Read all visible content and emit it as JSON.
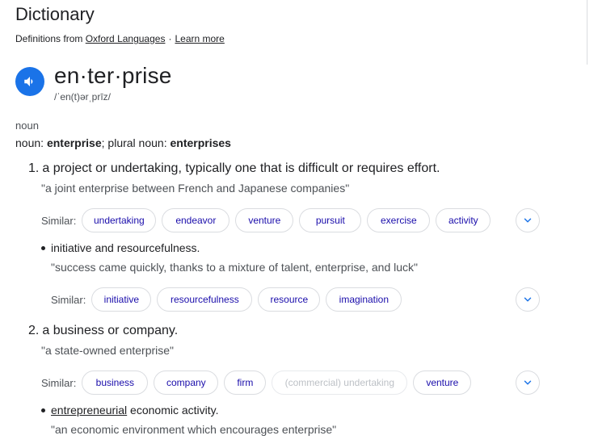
{
  "title": "Dictionary",
  "source": {
    "prefix": "Definitions from",
    "provider_link": "Oxford Languages",
    "separator": "·",
    "learn_more": "Learn more"
  },
  "entry": {
    "headword": "en·ter·prise",
    "phonetic": "/ˈen(t)ərˌprīz/",
    "part_of_speech": "noun",
    "forms": {
      "noun_label": "noun:",
      "singular": "enterprise",
      "plural_label": "; plural noun:",
      "plural": "enterprises"
    },
    "similar_label": "Similar:",
    "senses": [
      {
        "number": "1.",
        "definition": "a project or undertaking, typically one that is difficult or requires effort.",
        "example": "\"a joint enterprise between French and Japanese companies\"",
        "similar": [
          "undertaking",
          "endeavor",
          "venture",
          "pursuit",
          "exercise",
          "activity"
        ],
        "subsense": {
          "definition": "initiative and resourcefulness.",
          "example": "\"success came quickly, thanks to a mixture of talent, enterprise, and luck\"",
          "similar": [
            "initiative",
            "resourcefulness",
            "resource",
            "imagination"
          ]
        }
      },
      {
        "number": "2.",
        "definition": "a business or company.",
        "example": "\"a state-owned enterprise\"",
        "similar": [
          "business",
          "company",
          "firm",
          "(commercial) undertaking",
          "venture"
        ],
        "subsense": {
          "definition_link": "entrepreneurial",
          "definition_rest": " economic activity.",
          "example": "\"an economic environment which encourages enterprise\""
        }
      }
    ]
  },
  "colors": {
    "accent": "#1a73e8",
    "chip_text": "#1a0dab",
    "chip_border": "#dadce0",
    "secondary_text": "#4d5156"
  },
  "icons": {
    "speaker": "speaker-icon",
    "expand": "chevron-down-icon"
  }
}
